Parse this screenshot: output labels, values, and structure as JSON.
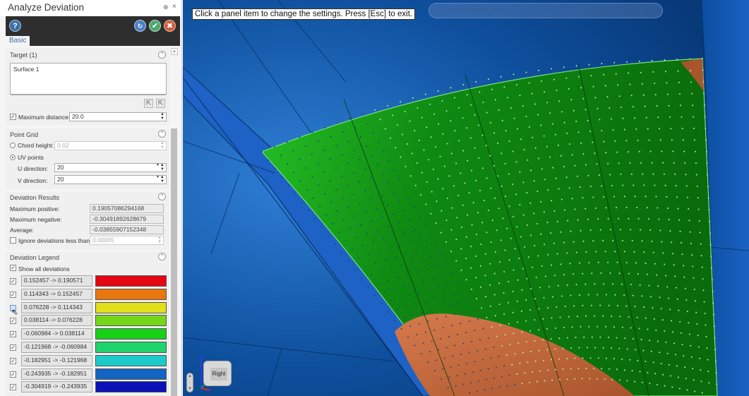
{
  "panel": {
    "title": "Analyze Deviation",
    "pin_icon": "⊕",
    "close_icon": "×",
    "toolbar": {
      "help_icon": "?",
      "apply_icon": "↻",
      "ok_icon": "✔",
      "cancel_icon": "✖"
    },
    "tab": "Basic",
    "target": {
      "header": "Target (1)",
      "items": [
        "Surface 1"
      ],
      "max_distance_checked": true,
      "max_distance_label": "Maximum distance:",
      "max_distance_value": "20.0"
    },
    "point_grid": {
      "header": "Point Grid",
      "chord_height_label": "Chord height:",
      "chord_height_value": "0.02",
      "chord_selected": false,
      "uv_points_label": "UV points",
      "uv_selected": true,
      "u_direction_label": "U direction:",
      "u_direction_value": "20",
      "v_direction_label": "V direction:",
      "v_direction_value": "20"
    },
    "results": {
      "header": "Deviation Results",
      "max_positive_label": "Maximum positive:",
      "max_positive_value": "0.19057086294168",
      "max_negative_label": "Maximum negative:",
      "max_negative_value": "-0.30491892628679",
      "average_label": "Average:",
      "average_value": "-0.03855907152348",
      "ignore_label": "Ignore deviations less than:",
      "ignore_checked": false,
      "ignore_value": "0.00005"
    },
    "legend": {
      "header": "Deviation Legend",
      "show_all_label": "Show all deviations",
      "show_all_checked": true,
      "rows": [
        {
          "range": "0.152457 -> 0.190571",
          "color": "#e30613",
          "checked": true
        },
        {
          "range": "0.114343 -> 0.152457",
          "color": "#e8770e",
          "checked": true
        },
        {
          "range": "0.076228 -> 0.114343",
          "color": "#e3e01a",
          "checked": false
        },
        {
          "range": "0.038114 -> 0.076228",
          "color": "#74d61a",
          "checked": true
        },
        {
          "range": "-0.060984 -> 0.038114",
          "color": "#17d117",
          "checked": true
        },
        {
          "range": "-0.121968 -> -0.060984",
          "color": "#1fd46d",
          "checked": true
        },
        {
          "range": "-0.182951 -> -0.121968",
          "color": "#1ccbc9",
          "checked": true
        },
        {
          "range": "-0.243935 -> -0.182951",
          "color": "#1464c4",
          "checked": true
        },
        {
          "range": "-0.304919 -> -0.243935",
          "color": "#0b12b5",
          "checked": true
        }
      ]
    }
  },
  "viewport": {
    "hint": "Click a panel item to change the settings. Press [Esc] to exit.",
    "toolbar_label": "AutoCursor",
    "view_cube_face": "Right"
  }
}
